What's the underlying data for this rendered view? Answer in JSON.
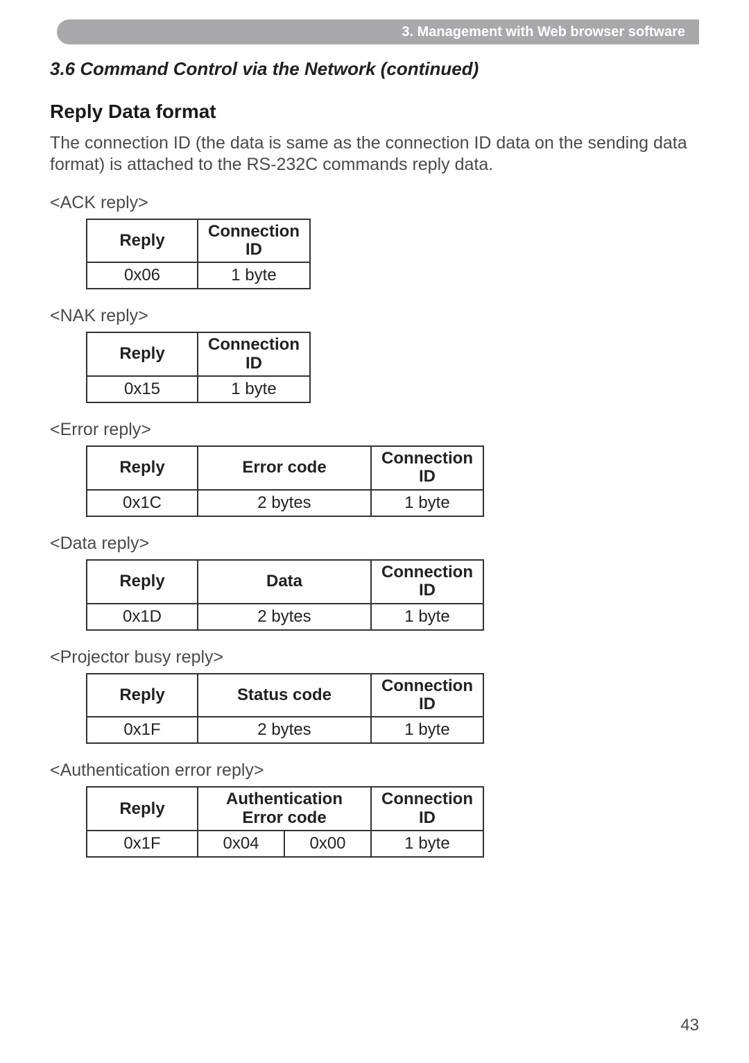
{
  "chapter_bar": "3. Management with Web browser software",
  "section_title": "3.6 Command Control via the Network (continued)",
  "sub_heading": "Reply Data format",
  "intro": "The connection ID (the data is same as the connection ID data on the sending data format) is attached to the RS-232C commands reply data.",
  "labels": {
    "ack": "<ACK reply>",
    "nak": "<NAK reply>",
    "error": "<Error reply>",
    "data": "<Data reply>",
    "busy": "<Projector busy reply>",
    "auth": "<Authentication error reply>"
  },
  "headers": {
    "reply": "Reply",
    "conn": "Connection\nID",
    "error_code": "Error code",
    "data": "Data",
    "status_code": "Status code",
    "auth_code": "Authentication\nError code"
  },
  "rows": {
    "ack": {
      "reply": "0x06",
      "conn": "1 byte"
    },
    "nak": {
      "reply": "0x15",
      "conn": "1 byte"
    },
    "error": {
      "reply": "0x1C",
      "mid": "2 bytes",
      "conn": "1 byte"
    },
    "data": {
      "reply": "0x1D",
      "mid": "2 bytes",
      "conn": "1 byte"
    },
    "busy": {
      "reply": "0x1F",
      "mid": "2 bytes",
      "conn": "1 byte"
    },
    "auth": {
      "reply": "0x1F",
      "a": "0x04",
      "b": "0x00",
      "conn": "1 byte"
    }
  },
  "page_number": "43"
}
